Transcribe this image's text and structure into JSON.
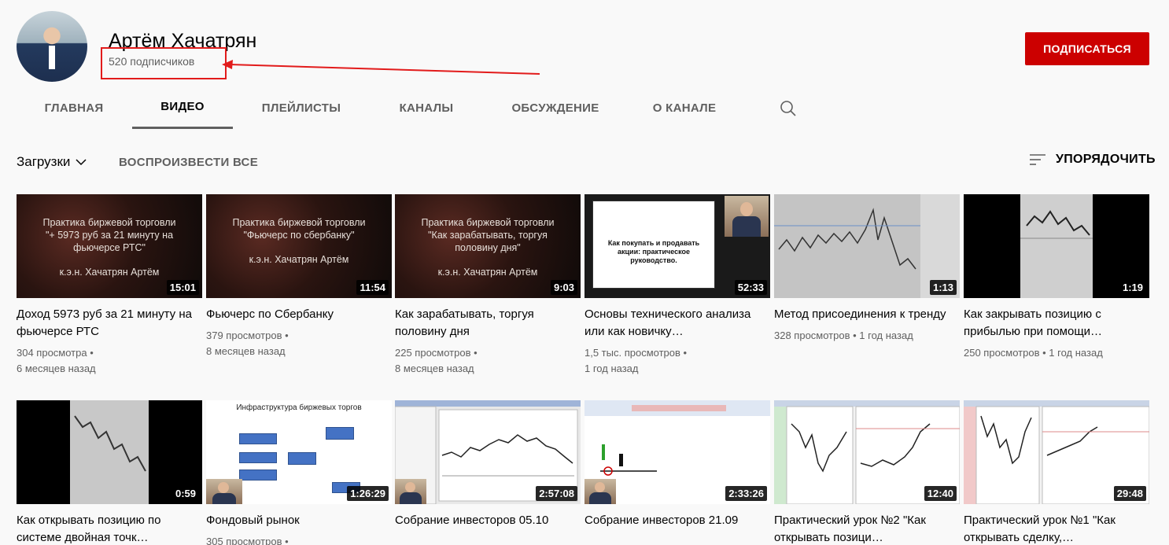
{
  "channel": {
    "name": "Артём Хачатрян",
    "subscribers": "520 подписчиков",
    "subscribe_label": "ПОДПИСАТЬСЯ"
  },
  "tabs": [
    "ГЛАВНАЯ",
    "ВИДЕО",
    "ПЛЕЙЛИСТЫ",
    "КАНАЛЫ",
    "ОБСУЖДЕНИЕ",
    "О КАНАЛЕ"
  ],
  "active_tab": "ВИДЕО",
  "toolbar": {
    "uploads_label": "Загрузки",
    "play_all_label": "ВОСПРОИЗВЕСТИ ВСЕ",
    "sort_label": "УПОРЯДОЧИТЬ"
  },
  "videos": [
    {
      "title": "Доход 5973 руб за 21 минуту на фьючерсе РТС",
      "views": "304 просмотра",
      "age": "6 месяцев назад",
      "duration": "15:01",
      "thumb_lines": [
        "Практика биржевой торговли",
        "\"+ 5973 руб за 21 минуту на",
        "фьючерсе РТС\""
      ],
      "thumb_author": "к.э.н. Хачатрян Артём"
    },
    {
      "title": "Фьючерс по Сбербанку",
      "views": "379 просмотров",
      "age": "8 месяцев назад",
      "duration": "11:54",
      "thumb_lines": [
        "Практика биржевой торговли",
        "\"Фьючерс по сбербанку\""
      ],
      "thumb_author": "к.э.н. Хачатрян Артём"
    },
    {
      "title": "Как зарабатывать, торгуя половину дня",
      "views": "225 просмотров",
      "age": "8 месяцев назад",
      "duration": "9:03",
      "thumb_lines": [
        "Практика биржевой торговли",
        "\"Как зарабатывать, торгуя",
        "половину дня\""
      ],
      "thumb_author": "к.э.н. Хачатрян Артём"
    },
    {
      "title": "Основы технического анализа или как новичку…",
      "views": "1,5 тыс. просмотров",
      "age": "1 год назад",
      "duration": "52:33",
      "thumb_text": "Как покупать и продавать акции: практическое руководство."
    },
    {
      "title": "Метод присоединения к тренду",
      "views": "328 просмотров",
      "age": "1 год назад",
      "duration": "1:13"
    },
    {
      "title": "Как закрывать позицию с прибылью при помощи…",
      "views": "250 просмотров",
      "age": "1 год назад",
      "duration": "1:19"
    },
    {
      "title": "Как открывать позицию по системе двойная точк…",
      "views": "",
      "age": "",
      "duration": "0:59"
    },
    {
      "title": "Фондовый рынок",
      "views": "305 просмотров",
      "age": "",
      "duration": "1:26:29",
      "thumb_text": "Инфраструктура биржевых торгов"
    },
    {
      "title": "Собрание инвесторов 05.10",
      "views": "",
      "age": "",
      "duration": "2:57:08"
    },
    {
      "title": "Собрание инвесторов 21.09",
      "views": "",
      "age": "",
      "duration": "2:33:26"
    },
    {
      "title": "Практический урок №2 \"Как открывать позици…",
      "views": "",
      "age": "",
      "duration": "12:40"
    },
    {
      "title": "Практический урок №1 \"Как открывать сделку,…",
      "views": "",
      "age": "",
      "duration": "29:48"
    }
  ],
  "colors": {
    "accent": "#cc0000",
    "annotation": "#e21b1b",
    "muted": "#606060"
  }
}
